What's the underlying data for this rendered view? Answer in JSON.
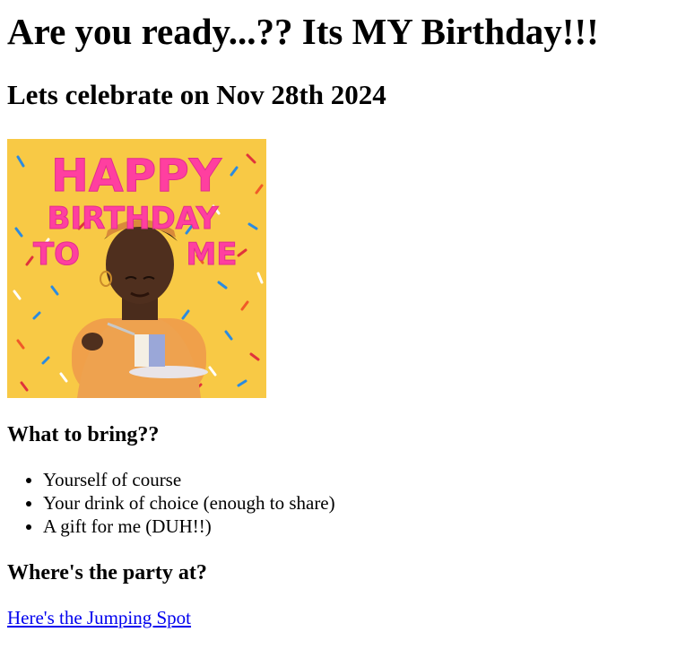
{
  "header": {
    "title": "Are you ready...?? Its MY Birthday!!!",
    "subtitle": "Lets celebrate on Nov 28th 2024"
  },
  "gif": {
    "line1": "HAPPY",
    "line2": "BIRTHDAY",
    "line3a": "TO",
    "line3b": "ME",
    "background_color": "#f8c945",
    "text_color": "#ff3fa0"
  },
  "bring": {
    "heading": "What to bring??",
    "items": [
      "Yourself of course",
      "Your drink of choice (enough to share)",
      "A gift for me (DUH!!)"
    ]
  },
  "location": {
    "heading": "Where's the party at?",
    "link_text": "Here's the Jumping Spot",
    "link_color": "#0000ee"
  }
}
